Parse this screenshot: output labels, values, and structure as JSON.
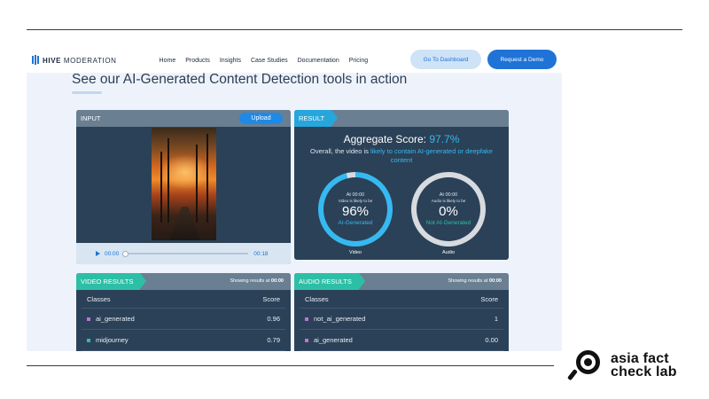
{
  "nav": {
    "logo_bold": "HIVE",
    "logo_light": "MODERATION",
    "links": [
      "Home",
      "Products",
      "Insights",
      "Case Studies",
      "Documentation",
      "Pricing"
    ],
    "dashboard_label": "Go To Dashboard",
    "demo_label": "Request a Demo"
  },
  "headline": "See our AI-Generated Content Detection tools in action",
  "input": {
    "title": "INPUT",
    "upload_label": "Upload",
    "current_time": "00:00",
    "duration": "00:18"
  },
  "result": {
    "title": "RESULT",
    "aggregate_label": "Aggregate Score:",
    "aggregate_value": "97.7%",
    "summary_prefix": "Overall, the video is ",
    "summary_highlight": "likely to contain AI-generated or deepfake content",
    "video_gauge": {
      "at": "At 00:00",
      "likely": "Video is likely to be",
      "pct": "96%",
      "label": "AI-Generated",
      "caption": "Video",
      "fraction": 0.96,
      "color": "#36b9f0"
    },
    "audio_gauge": {
      "at": "At 00:00",
      "likely": "Audio is likely to be",
      "pct": "0%",
      "label": "Not AI-Generated",
      "caption": "Audio",
      "fraction": 0.0,
      "color": "#d7dbe0"
    }
  },
  "video_results": {
    "title": "VIDEO RESULTS",
    "showing_prefix": "Showing results at ",
    "showing_time": "00:00",
    "col_classes": "Classes",
    "col_score": "Score",
    "rows": [
      {
        "cls": "ai_generated",
        "score": "0.96",
        "color": "#c56fd9"
      },
      {
        "cls": "midjourney",
        "score": "0.79",
        "color": "#2dbfa6"
      }
    ]
  },
  "audio_results": {
    "title": "AUDIO RESULTS",
    "showing_prefix": "Showing results at ",
    "showing_time": "00:00",
    "col_classes": "Classes",
    "col_score": "Score",
    "rows": [
      {
        "cls": "not_ai_generated",
        "score": "1",
        "color": "#c56fd9"
      },
      {
        "cls": "ai_generated",
        "score": "0.00",
        "color": "#c56fd9"
      }
    ]
  },
  "brand": {
    "line1": "asia fact",
    "line2": "check lab"
  }
}
